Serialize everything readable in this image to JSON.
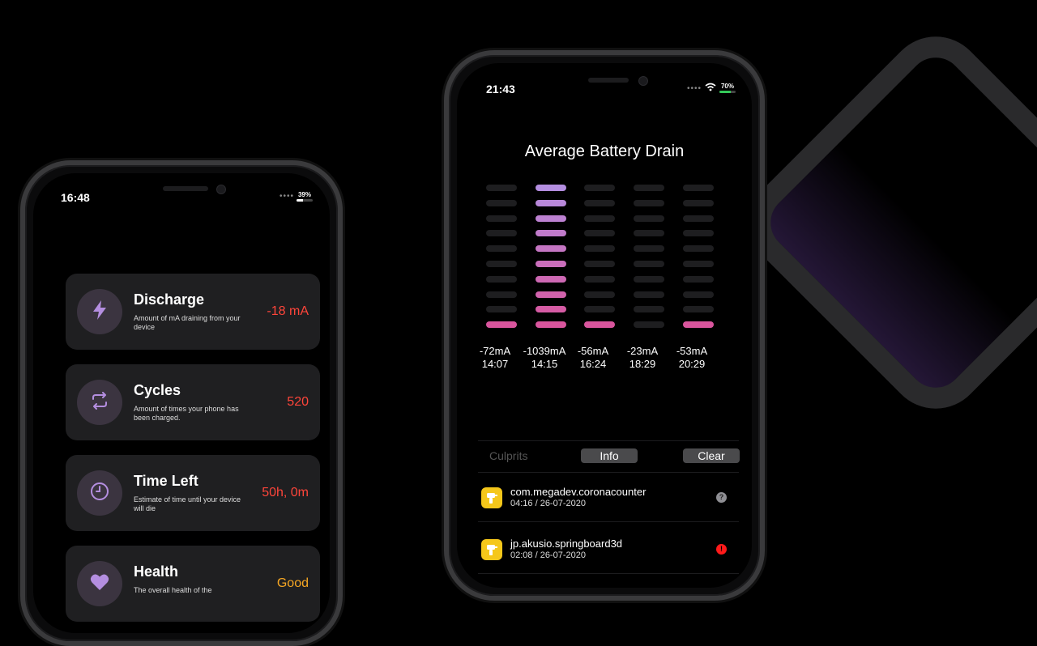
{
  "left_phone": {
    "time": "16:48",
    "battery_percent": "39%",
    "battery_level": 0.39,
    "cards": [
      {
        "title": "Discharge",
        "desc": "Amount of mA draining from your device",
        "value": "-18 mA",
        "value_color": "#ff453a",
        "icon": "bolt-icon"
      },
      {
        "title": "Cycles",
        "desc": "Amount of times your phone has been charged.",
        "value": "520",
        "value_color": "#ff453a",
        "icon": "repeat-icon"
      },
      {
        "title": "Time Left",
        "desc": "Estimate of time until your device will die",
        "value": "50h, 0m",
        "value_color": "#ff453a",
        "icon": "clock-icon"
      },
      {
        "title": "Health",
        "desc": "The overall health of the",
        "value": "Good",
        "value_color": "#f5a623",
        "icon": "heart-icon"
      }
    ]
  },
  "right_phone": {
    "time": "21:43",
    "battery_percent": "70%",
    "battery_level": 0.7,
    "chart_title": "Average Battery Drain",
    "chart_data": {
      "type": "bar",
      "title": "Average Battery Drain",
      "categories": [
        "14:07",
        "14:15",
        "16:24",
        "18:29",
        "20:29"
      ],
      "value_labels": [
        "-72mA",
        "-1039mA",
        "-56mA",
        "-23mA",
        "-53mA"
      ],
      "values": [
        -72,
        -1039,
        -56,
        -23,
        -53
      ],
      "lit_segments": [
        1,
        10,
        1,
        0,
        1
      ],
      "total_segments": 10
    },
    "toolbar": {
      "label": "Culprits",
      "info": "Info",
      "clear": "Clear"
    },
    "culprits": [
      {
        "name": "com.megadev.coronacounter",
        "date": "04:16 / 26-07-2020",
        "badge": "?",
        "badge_color": "#8e8e93"
      },
      {
        "name": "jp.akusio.springboard3d",
        "date": "02:08 / 26-07-2020",
        "badge": "!",
        "badge_color": "#ff1a1a"
      }
    ]
  },
  "colors": {
    "accent_purple": "#b48ee0",
    "accent_pink": "#d9559d",
    "danger": "#ff453a",
    "warning": "#f5a623"
  }
}
